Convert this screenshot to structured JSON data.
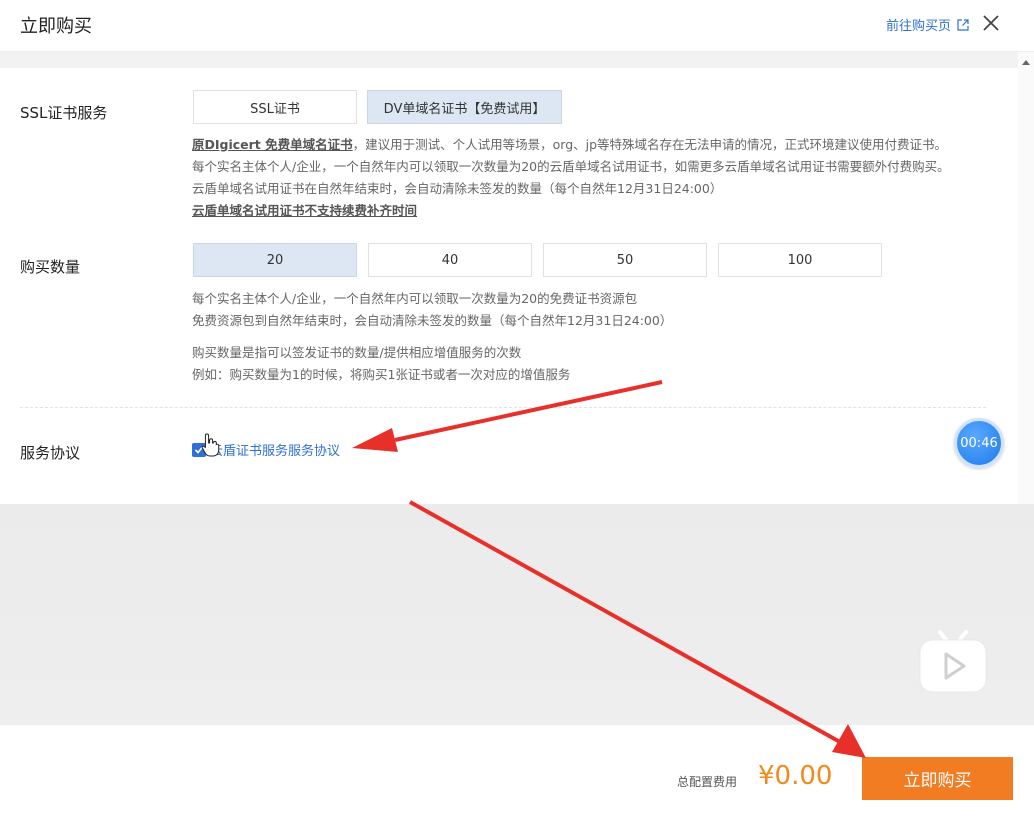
{
  "header": {
    "title": "立即购买",
    "link": "前往购买页"
  },
  "ssl": {
    "label": "SSL证书服务",
    "options": [
      "SSL证书",
      "DV单域名证书【免费试用】"
    ],
    "selected": "DV单域名证书【免费试用】",
    "desc_bold": "原DIgicert 免费单域名证书",
    "desc_line1": "，建议用于测试、个人试用等场景，org、jp等特殊域名存在无法申请的情况，正式环境建议使用付费证书。",
    "desc_line2": "每个实名主体个人/企业，一个自然年内可以领取一次数量为20的云盾单域名试用证书，如需更多云盾单域名试用证书需要额外付费购买。",
    "desc_line3": "云盾单域名试用证书在自然年结束时，会自动清除未签发的数量（每个自然年12月31日24:00）",
    "desc_line4": "云盾单域名试用证书不支持续费补齐时间"
  },
  "quantity": {
    "label": "购买数量",
    "options": [
      "20",
      "40",
      "50",
      "100"
    ],
    "selected": "20",
    "desc_line1": "每个实名主体个人/企业，一个自然年内可以领取一次数量为20的免费证书资源包",
    "desc_line2": "免费资源包到自然年结束时，会自动清除未签发的数量（每个自然年12月31日24:00）",
    "desc_line3": "购买数量是指可以签发证书的数量/提供相应增值服务的次数",
    "desc_line4": "例如：购买数量为1的时候，将购买1张证书或者一次对应的增值服务"
  },
  "agreement": {
    "label": "服务协议",
    "link": "云盾证书服务服务协议",
    "checked": true
  },
  "timer": "00:46",
  "footer": {
    "total_label": "总配置费用",
    "total_price": "¥0.00",
    "buy_label": "立即购买"
  },
  "colors": {
    "accent": "#f27c22",
    "link": "#2f6fd6",
    "selected_bg": "#dde6f3",
    "annotation_arrow": "#e8302a"
  },
  "icons": [
    "external-link-icon",
    "close-icon",
    "check-icon",
    "hand-cursor-icon",
    "play-icon",
    "scroll-up-icon"
  ]
}
